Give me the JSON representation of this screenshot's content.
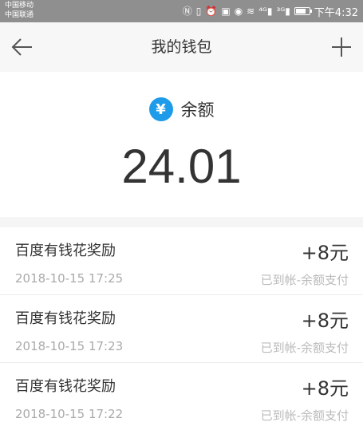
{
  "status_bar": {
    "carrier1": "中国移动",
    "carrier2": "中国联通",
    "network1": "⁴ᴳ",
    "network2": "³ᴳ",
    "time": "下午4:32",
    "battery_level": 0.75,
    "bg_color": "#8f8f8f"
  },
  "nav": {
    "title": "我的钱包",
    "back_icon": "arrow-left-icon",
    "add_icon": "plus-icon"
  },
  "balance": {
    "icon_symbol": "¥",
    "icon_color": "#1e9be9",
    "label": "余额",
    "amount": "24.01"
  },
  "transactions": [
    {
      "title": "百度有钱花奖励",
      "date": "2018-10-15 17:25",
      "amount": "+8元",
      "status": "已到帐-余额支付"
    },
    {
      "title": "百度有钱花奖励",
      "date": "2018-10-15 17:23",
      "amount": "+8元",
      "status": "已到帐-余额支付"
    },
    {
      "title": "百度有钱花奖励",
      "date": "2018-10-15 17:22",
      "amount": "+8元",
      "status": "已到帐-余额支付"
    }
  ]
}
